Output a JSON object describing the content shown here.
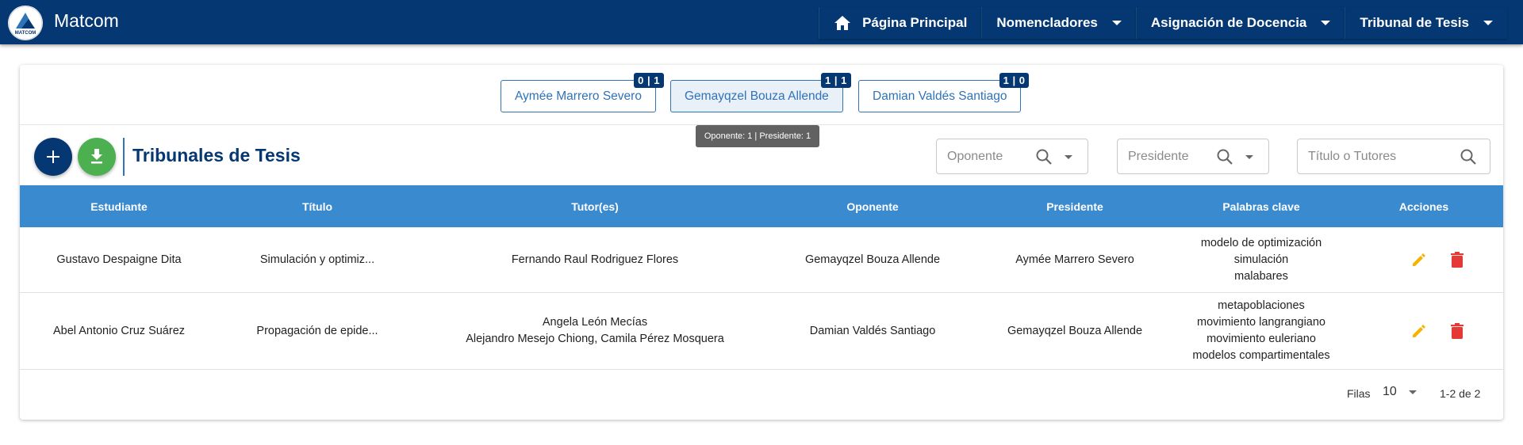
{
  "header": {
    "logo_text": "MATCOM",
    "title": "Matcom",
    "nav": [
      {
        "label": "Página Principal",
        "icon": "home-icon",
        "dropdown": false
      },
      {
        "label": "Nomencladores",
        "dropdown": true
      },
      {
        "label": "Asignación de Docencia",
        "dropdown": true
      },
      {
        "label": "Tribunal de Tesis",
        "dropdown": true
      }
    ]
  },
  "professors": [
    {
      "name": "Aymée Marrero Severo",
      "badge": "0 | 1",
      "active": false
    },
    {
      "name": "Gemayqzel Bouza Allende",
      "badge": "1 | 1",
      "active": true
    },
    {
      "name": "Damian Valdés Santiago",
      "badge": "1 | 0",
      "active": false
    }
  ],
  "tooltip": "Oponente: 1 | Presidente: 1",
  "toolbar": {
    "add_icon": "plus-icon",
    "download_icon": "download-icon",
    "title": "Tribunales de Tesis"
  },
  "filters": {
    "oponente_placeholder": "Oponente",
    "presidente_placeholder": "Presidente",
    "search_placeholder": "Título o Tutores"
  },
  "table": {
    "columns": [
      "Estudiante",
      "Título",
      "Tutor(es)",
      "Oponente",
      "Presidente",
      "Palabras clave",
      "Acciones"
    ],
    "rows": [
      {
        "estudiante": "Gustavo Despaigne Dita",
        "titulo": "Simulación y optimiz...",
        "tutores": [
          "Fernando Raul Rodriguez Flores"
        ],
        "oponente": "Gemayqzel Bouza Allende",
        "presidente": "Aymée Marrero Severo",
        "palabras": [
          "modelo de optimización",
          "simulación",
          "malabares"
        ]
      },
      {
        "estudiante": "Abel Antonio Cruz Suárez",
        "titulo": "Propagación de epide...",
        "tutores": [
          "Angela León Mecías",
          "Alejandro Mesejo Chiong, Camila Pérez Mosquera"
        ],
        "oponente": "Damian Valdés Santiago",
        "presidente": "Gemayqzel Bouza Allende",
        "palabras": [
          "metapoblaciones",
          "movimiento langrangiano",
          "movimiento euleriano",
          "modelos compartimentales"
        ]
      }
    ],
    "edit_icon": "pencil-icon",
    "delete_icon": "trash-icon"
  },
  "pagination": {
    "rows_label": "Filas",
    "rows_per_page": "10",
    "range": "1-2 de 2"
  },
  "colors": {
    "navbar": "#053872",
    "table_header": "#3a8ad0",
    "accent": "#2f73b8",
    "download_fab": "#4caf50",
    "edit": "#f4b400",
    "delete": "#e53935"
  }
}
